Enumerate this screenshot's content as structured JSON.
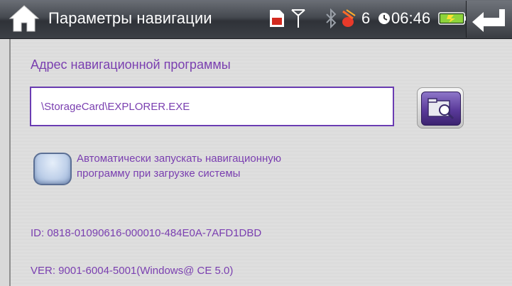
{
  "titlebar": {
    "title": "Параметры навигации",
    "satellites": "6",
    "time": "06:46",
    "icons": [
      "home-icon",
      "sd-card-icon",
      "antenna-icon",
      "bluetooth-icon",
      "gps-satellite-icon",
      "clock-icon",
      "battery-icon",
      "back-arrow-icon"
    ]
  },
  "nav": {
    "address_label": "Адрес навигационной программы",
    "path_value": "\\StorageCard\\EXPLORER.EXE",
    "autostart_label": "Автоматически запускать навигационную программу при загрузке системы",
    "autostart_checked": false
  },
  "info": {
    "id": "ID:  0818-01090616-000010-484E0A-7AFD1DBD",
    "ver": "VER:  9001-6004-5001(Windows@ CE 5.0)"
  },
  "colors": {
    "accent": "#7a3fb0",
    "titlebar": "#3c4046",
    "panel": "#dcdcdc"
  }
}
